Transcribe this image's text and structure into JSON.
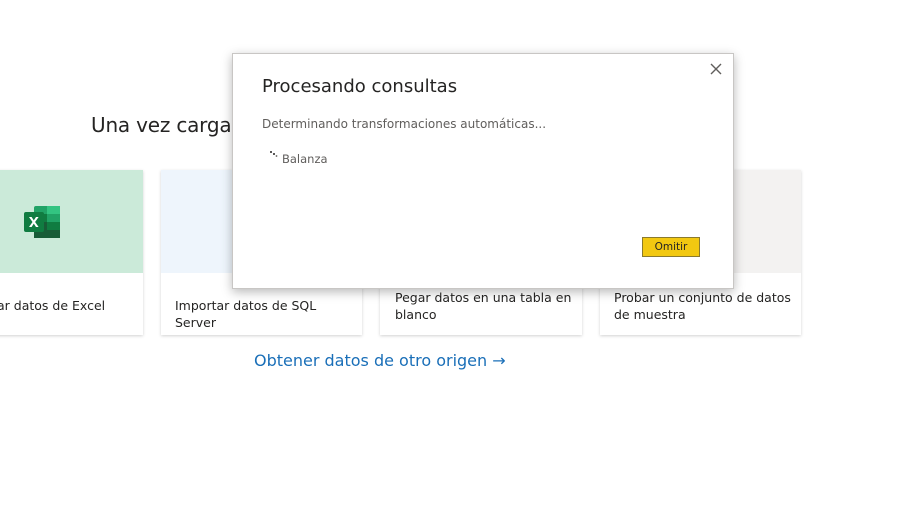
{
  "background": {
    "heading": "Una vez cargad"
  },
  "cards": [
    {
      "label": "ar datos de Excel",
      "band_color": "#cbead9",
      "icon": "excel-icon"
    },
    {
      "label": "Importar datos de SQL Server",
      "band_color": "#eef5fc"
    },
    {
      "label": "Pegar datos en una tabla en blanco",
      "band_color": "#ffffff"
    },
    {
      "label": "Probar un conjunto de datos de muestra",
      "band_color": "#f3f2f1"
    }
  ],
  "other_source_link": "Obtener datos de otro origen →",
  "dialog": {
    "title": "Procesando consultas",
    "status": "Determinando transformaciones automáticas...",
    "query_name": "Balanza",
    "skip_label": "Omitir",
    "close_icon": "close-icon",
    "spinner_icon": "loading-spinner-icon"
  },
  "colors": {
    "link": "#1a6fb8",
    "skip_button": "#f2c811"
  }
}
